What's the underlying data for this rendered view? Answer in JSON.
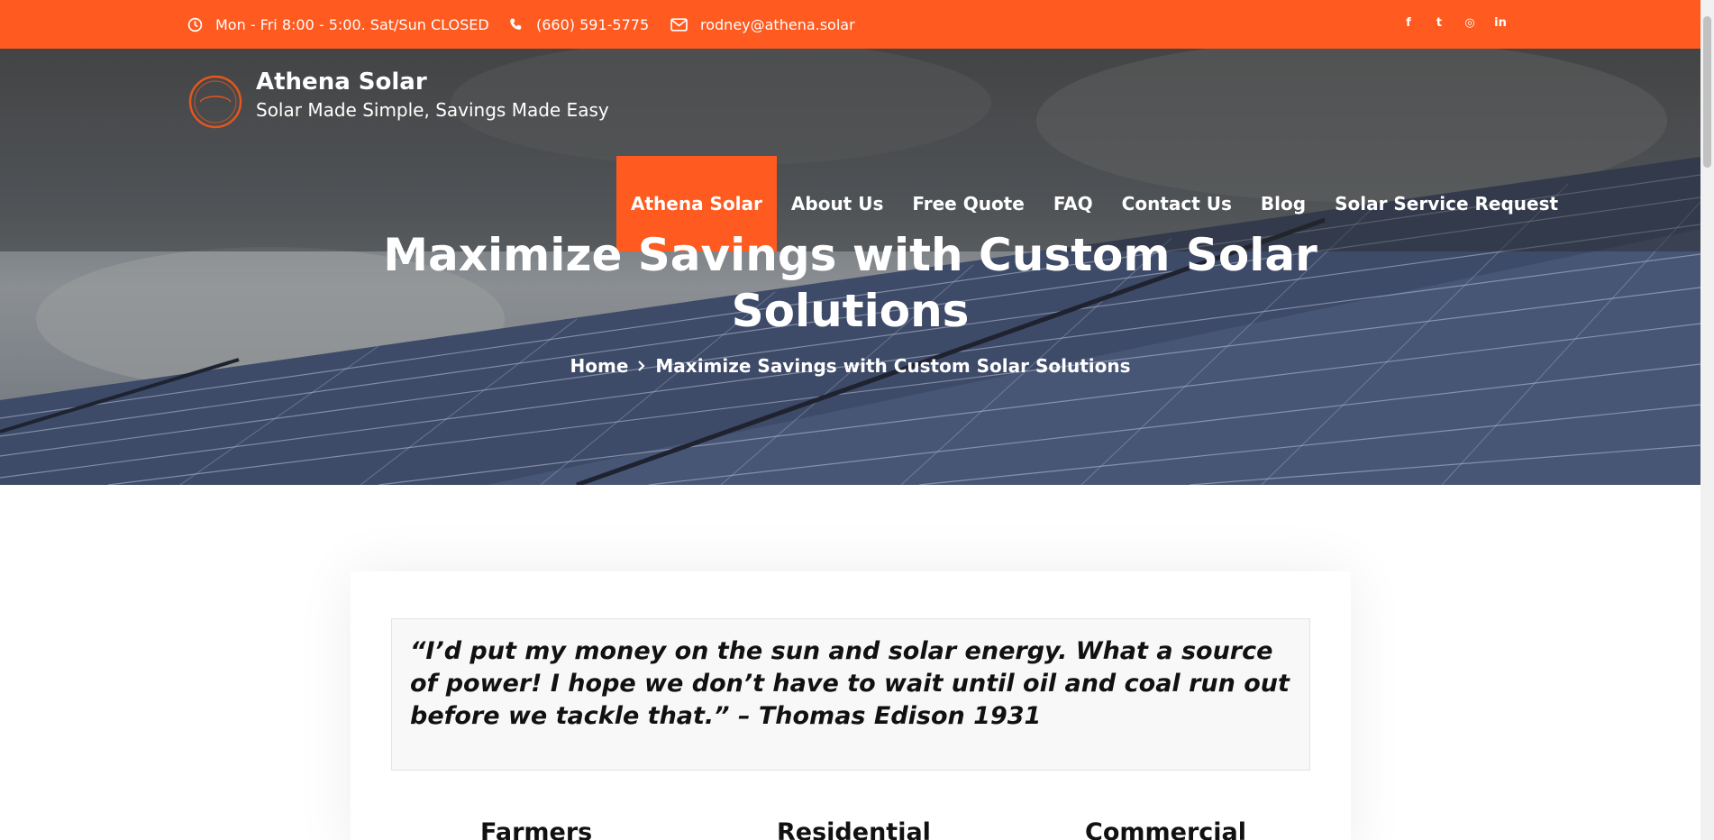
{
  "topbar": {
    "hours": "Mon - Fri 8:00 - 5:00. Sat/Sun CLOSED",
    "phone": "(660) 591-5775",
    "email": "rodney@athena.solar",
    "social": [
      {
        "icon": "facebook-icon",
        "glyph": "f"
      },
      {
        "icon": "twitter-icon",
        "glyph": "t"
      },
      {
        "icon": "instagram-icon",
        "glyph": "◎"
      },
      {
        "icon": "linkedin-icon",
        "glyph": "in"
      }
    ]
  },
  "brand": {
    "name": "Athena Solar",
    "tagline": "Solar Made Simple, Savings Made Easy"
  },
  "nav": [
    {
      "label": "Athena Solar",
      "active": true
    },
    {
      "label": "About Us"
    },
    {
      "label": "Free Quote"
    },
    {
      "label": "FAQ"
    },
    {
      "label": "Contact Us"
    },
    {
      "label": "Blog"
    },
    {
      "label": "Solar Service Request"
    }
  ],
  "hero": {
    "title_line1": "Maximize Savings with Custom Solar",
    "title_line2": "Solutions",
    "breadcrumb_home": "Home",
    "breadcrumb_current": "Maximize Savings with Custom Solar Solutions"
  },
  "content": {
    "quote": "“I’d put my money on the sun and solar energy. What a source of power! I hope we don’t have to wait until oil and coal run out before we tackle that.” – Thomas Edison 1931",
    "columns": [
      "Farmers",
      "Residential",
      "Commercial"
    ]
  },
  "colors": {
    "accent": "#ff5a1f"
  }
}
